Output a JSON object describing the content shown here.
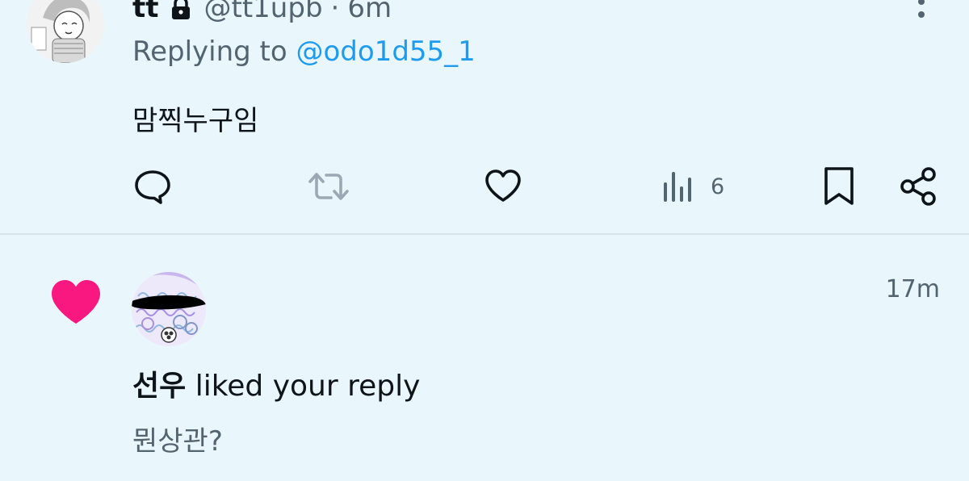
{
  "tweet": {
    "display_name": "tt",
    "handle": "@tt1upb",
    "separator": "·",
    "time": "6m",
    "replying_prefix": "Replying to ",
    "replying_to": "@odo1d55_1",
    "text": "맘찍누구임",
    "views_count": "6",
    "icons": {
      "lock": "lock-icon",
      "more": "more-vertical-icon",
      "reply": "reply-bubble-icon",
      "retweet": "retweet-icon",
      "like": "heart-outline-icon",
      "views": "views-bar-chart-icon",
      "bookmark": "bookmark-icon",
      "share": "share-icon"
    }
  },
  "notification": {
    "icon": "heart-filled-icon",
    "time": "17m",
    "user": "선우",
    "action_text": " liked your reply",
    "quoted_text": "뭔상관?"
  },
  "colors": {
    "background": "#e9f7fd",
    "text_primary": "#0f1419",
    "text_secondary": "#536471",
    "link": "#1d9bf0",
    "like_pink": "#f91880",
    "retweet_gray": "#9aa9b4"
  }
}
